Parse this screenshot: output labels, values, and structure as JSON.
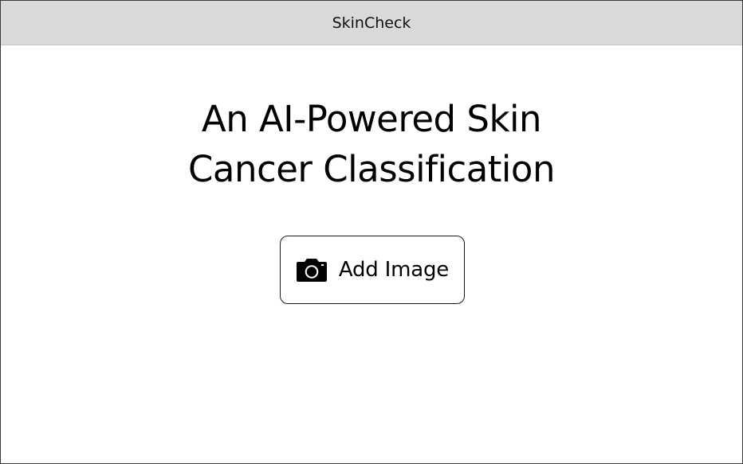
{
  "app": {
    "title": "SkinCheck"
  },
  "hero": {
    "line1": "An AI-Powered Skin",
    "line2": "Cancer Classification"
  },
  "actions": {
    "add_image_label": "Add Image",
    "add_image_icon": "camera-icon"
  },
  "colors": {
    "titlebar_bg": "#d9d9d9",
    "text": "#000000",
    "button_border": "#1a1a1a"
  }
}
